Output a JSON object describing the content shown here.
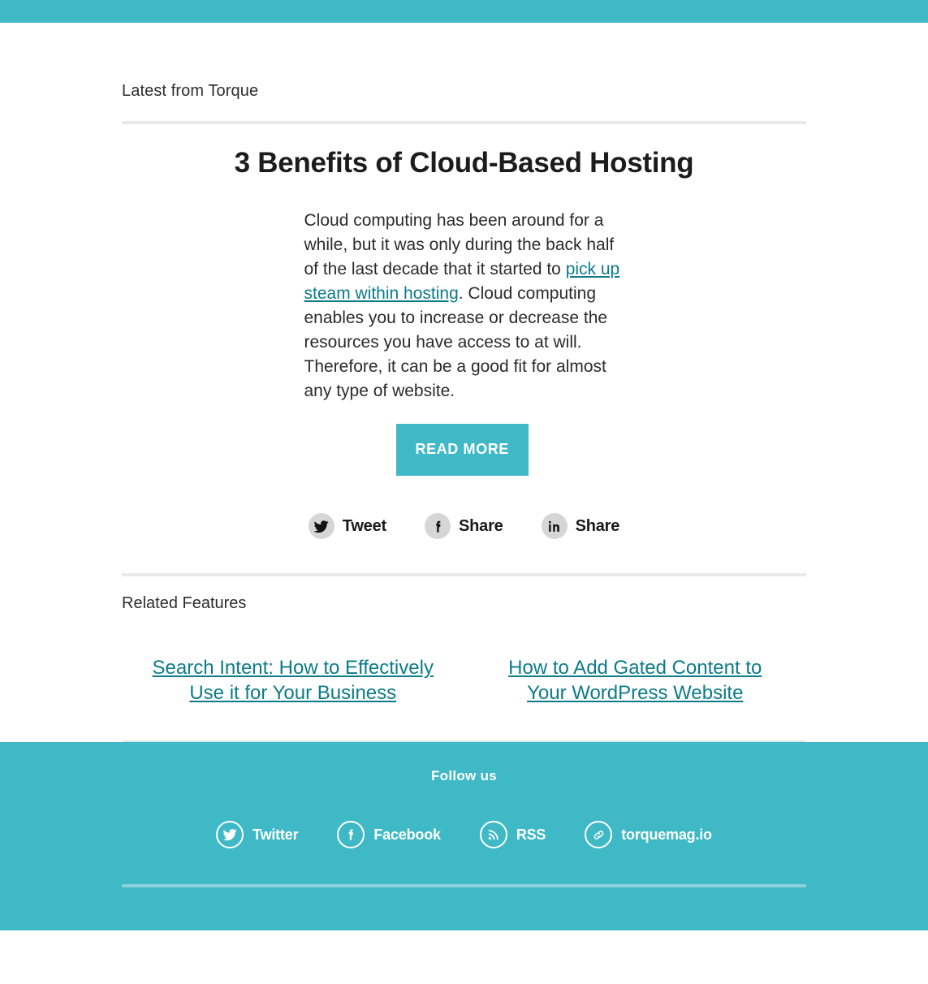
{
  "theme": {
    "accent": "#3fb9c6",
    "link": "#0c7b8a",
    "rule": "#e8e8e8",
    "footer_rule": "#8cd2da",
    "share_circle": "#d6d6d6"
  },
  "header": {
    "eyebrow": "Latest from Torque"
  },
  "article": {
    "title": "3 Benefits of Cloud-Based Hosting",
    "body_part1": "Cloud computing has been around for a while, but it was only during the back half of the last decade that it started to ",
    "body_link": "pick up steam within hosting",
    "body_part2": ". Cloud computing enables you to increase or decrease the resources you have access to at will. Therefore, it can be a good fit for almost any type of website.",
    "read_more_label": "READ MORE"
  },
  "share": {
    "items": [
      {
        "icon": "twitter-icon",
        "label": "Tweet"
      },
      {
        "icon": "facebook-icon",
        "label": "Share"
      },
      {
        "icon": "linkedin-icon",
        "label": "Share"
      }
    ]
  },
  "related": {
    "heading": "Related Features",
    "items": [
      {
        "label": "Search Intent: How to Effectively Use it for Your Business"
      },
      {
        "label": "How to Add Gated Content to Your WordPress Website"
      }
    ]
  },
  "footer": {
    "follow_label": "Follow us",
    "social": [
      {
        "icon": "twitter-icon",
        "label": "Twitter"
      },
      {
        "icon": "facebook-icon",
        "label": "Facebook"
      },
      {
        "icon": "rss-icon",
        "label": "RSS"
      },
      {
        "icon": "link-icon",
        "label": "torquemag.io"
      }
    ]
  }
}
